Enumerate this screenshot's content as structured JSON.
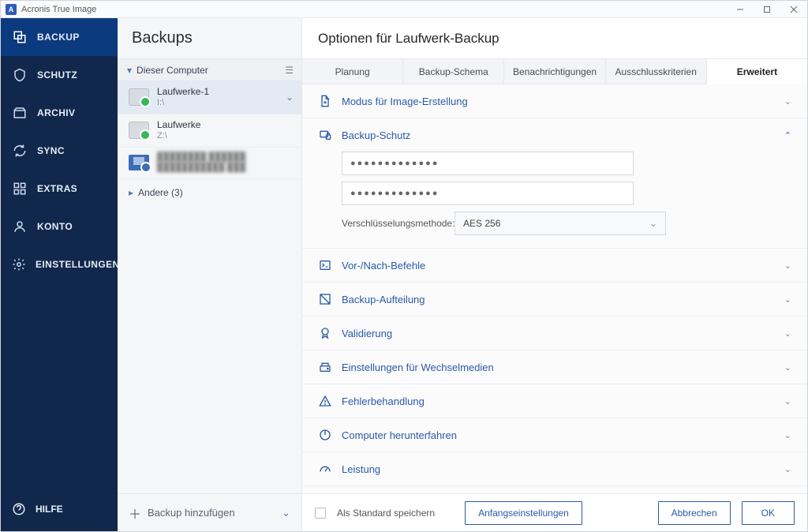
{
  "window": {
    "title": "Acronis True Image"
  },
  "sidebar": {
    "items": [
      {
        "label": "BACKUP"
      },
      {
        "label": "SCHUTZ"
      },
      {
        "label": "ARCHIV"
      },
      {
        "label": "SYNC"
      },
      {
        "label": "EXTRAS"
      },
      {
        "label": "KONTO"
      },
      {
        "label": "EINSTELLUNGEN"
      }
    ],
    "help": "HILFE"
  },
  "list": {
    "header": "Backups",
    "group": "Dieser Computer",
    "entries": [
      {
        "name": "Laufwerke-1",
        "sub": "I:\\"
      },
      {
        "name": "Laufwerke",
        "sub": "Z:\\"
      },
      {
        "name": "████████ ██████",
        "sub": "███████████ ███"
      }
    ],
    "other": "Andere (3)",
    "add": "Backup hinzufügen"
  },
  "main": {
    "title": "Optionen für Laufwerk-Backup",
    "tabs": [
      "Planung",
      "Backup-Schema",
      "Benachrichtigungen",
      "Ausschlusskriterien",
      "Erweitert"
    ],
    "accordions": [
      "Modus für Image-Erstellung",
      "Backup-Schutz",
      "Vor-/Nach-Befehle",
      "Backup-Aufteilung",
      "Validierung",
      "Einstellungen für Wechselmedien",
      "Fehlerbehandlung",
      "Computer herunterfahren",
      "Leistung"
    ],
    "protection": {
      "pwd1": "●●●●●●●●●●●●●",
      "pwd2": "●●●●●●●●●●●●●",
      "enc_label": "Verschlüsselungsmethode:",
      "enc_value": "AES 256"
    },
    "footer": {
      "save_default": "Als Standard speichern",
      "initial": "Anfangseinstellungen",
      "cancel": "Abbrechen",
      "ok": "OK"
    }
  }
}
